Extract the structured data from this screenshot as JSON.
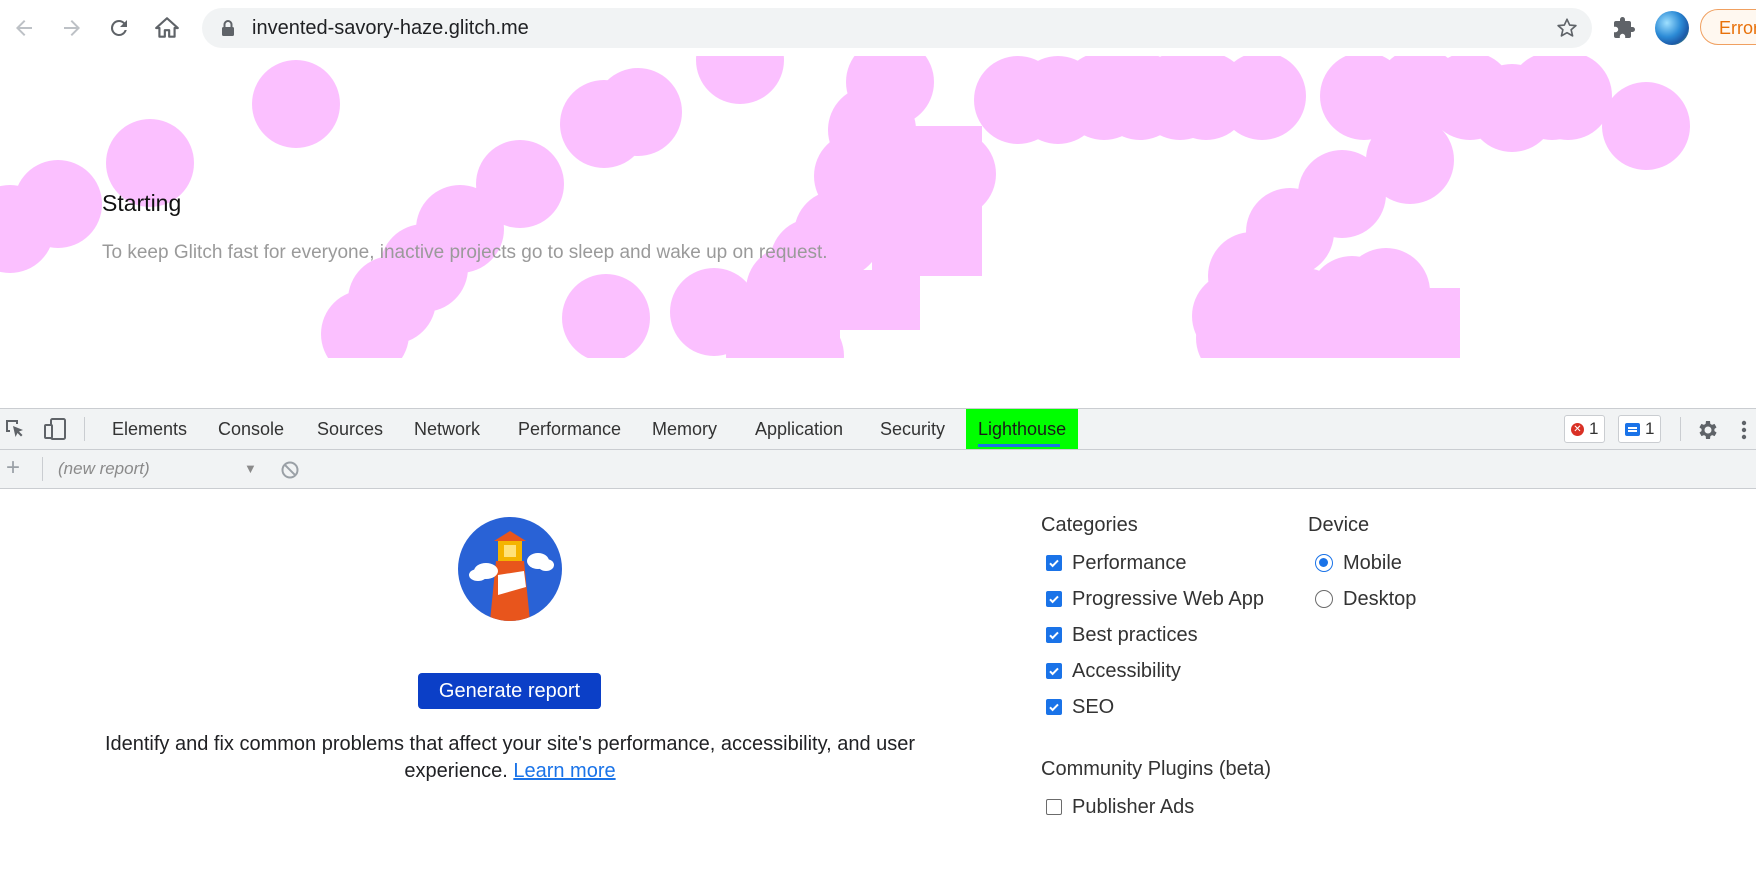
{
  "browser": {
    "url": "invented-savory-haze.glitch.me",
    "error_chip_label": "Error"
  },
  "page": {
    "title": "Starting",
    "subtitle": "To keep Glitch fast for everyone, inactive projects go to sleep and wake up on request.",
    "blob_color": "#fbc0ff"
  },
  "devtools": {
    "tabs": [
      "Elements",
      "Console",
      "Sources",
      "Network",
      "Performance",
      "Memory",
      "Application",
      "Security",
      "Lighthouse"
    ],
    "active_tab": "Lighthouse",
    "error_count": "1",
    "message_count": "1",
    "report_select": "(new report)"
  },
  "lighthouse": {
    "generate_label": "Generate report",
    "description": "Identify and fix common problems that affect your site's performance, accessibility, and user experience.",
    "learn_more": "Learn more",
    "categories_title": "Categories",
    "categories": [
      {
        "label": "Performance",
        "checked": true
      },
      {
        "label": "Progressive Web App",
        "checked": true
      },
      {
        "label": "Best practices",
        "checked": true
      },
      {
        "label": "Accessibility",
        "checked": true
      },
      {
        "label": "SEO",
        "checked": true
      }
    ],
    "device_title": "Device",
    "devices": [
      {
        "label": "Mobile",
        "selected": true
      },
      {
        "label": "Desktop",
        "selected": false
      }
    ],
    "plugins_title": "Community Plugins (beta)",
    "plugins": [
      {
        "label": "Publisher Ads",
        "checked": false
      }
    ]
  },
  "icons": {
    "back": "arrow-left-icon",
    "forward": "arrow-right-icon",
    "reload": "reload-icon",
    "home": "home-icon",
    "lock": "lock-icon",
    "star": "star-icon",
    "extensions": "puzzle-icon",
    "inspect": "inspect-element-icon",
    "device": "device-toggle-icon",
    "settings": "gear-icon",
    "more": "vertical-dots-icon",
    "clear": "block-icon"
  },
  "colors": {
    "accent": "#1a73e8",
    "active_tab_highlight": "#00ff00",
    "generate_button": "#0b3fc7"
  }
}
